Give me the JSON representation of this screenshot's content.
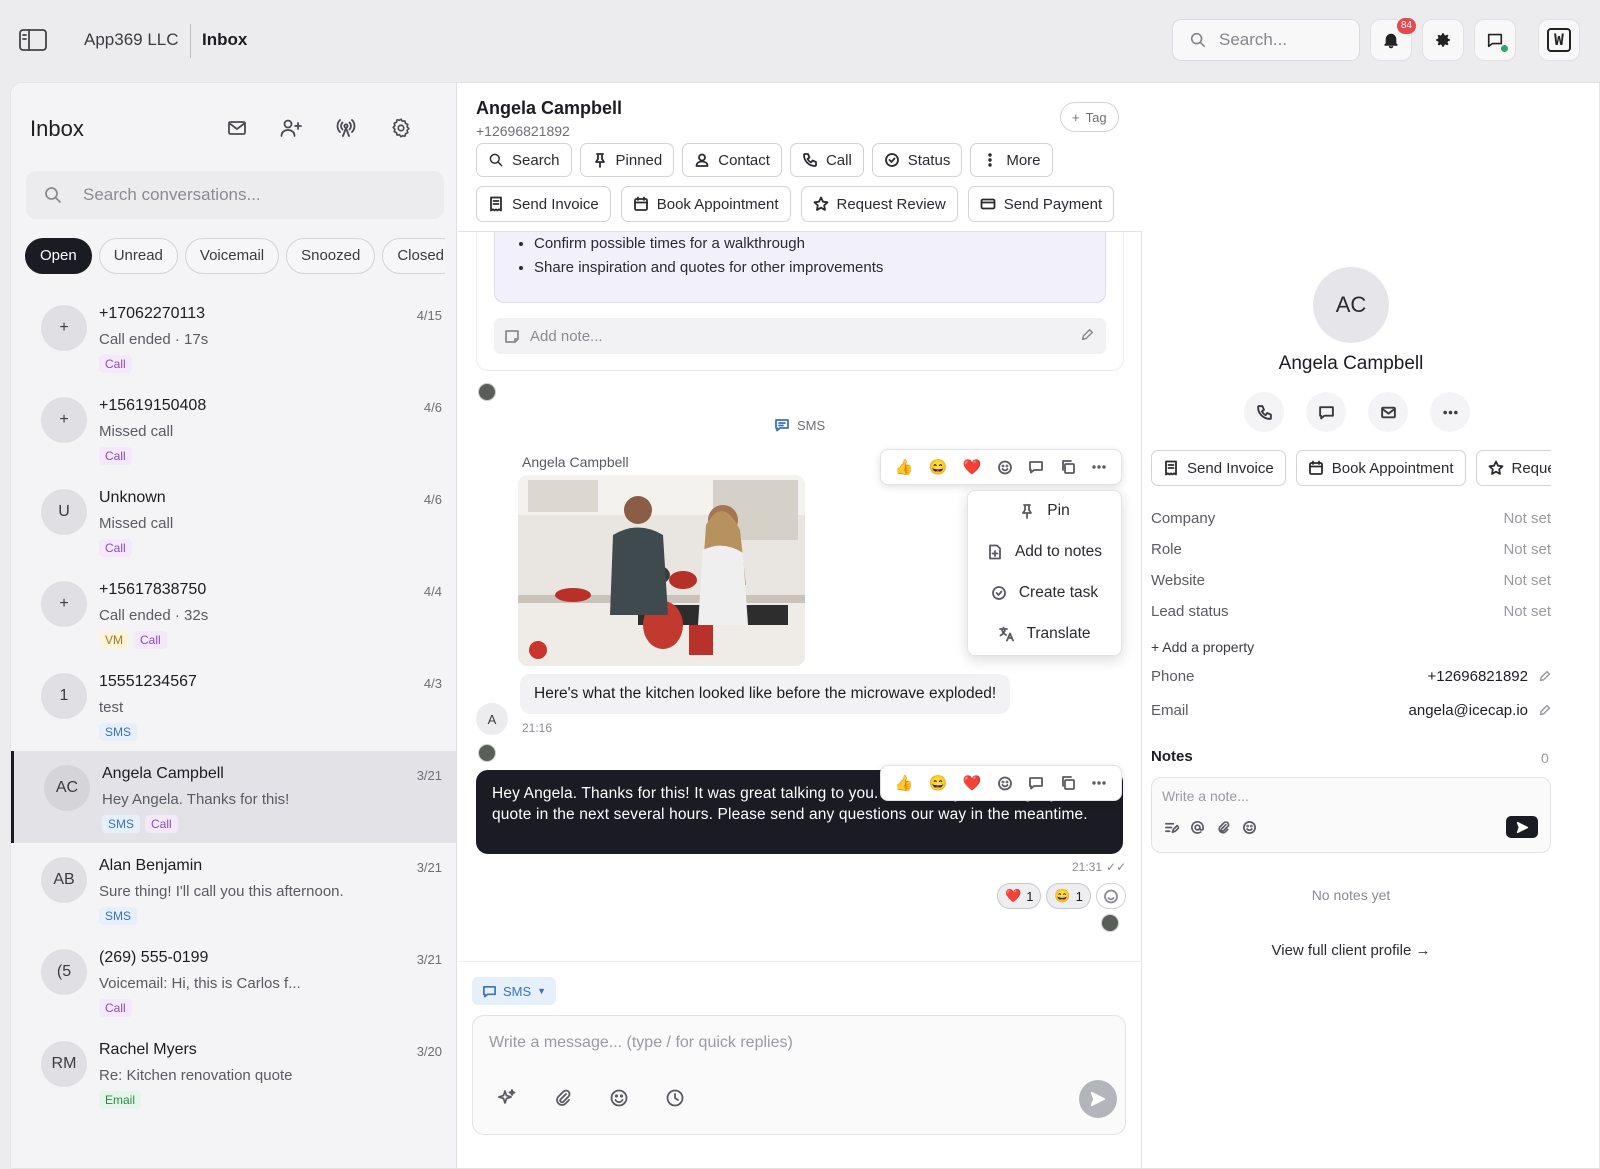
{
  "topbar": {
    "org": "App369 LLC",
    "crumb": "Inbox",
    "search_placeholder": "Search...",
    "notification_count": "84",
    "user_initial": "W"
  },
  "left": {
    "title": "Inbox",
    "search_placeholder": "Search conversations...",
    "filters": [
      "Open",
      "Unread",
      "Voicemail",
      "Snoozed",
      "Closed"
    ],
    "conversations": [
      {
        "avatar": "+",
        "name": "+17062270113",
        "date": "4/15",
        "preview": "Call ended · 17s",
        "tags": [
          "Call"
        ]
      },
      {
        "avatar": "+",
        "name": "+15619150408",
        "date": "4/6",
        "preview": "Missed call",
        "tags": [
          "Call"
        ]
      },
      {
        "avatar": "U",
        "name": "Unknown",
        "date": "4/6",
        "preview": "Missed call",
        "tags": [
          "Call"
        ]
      },
      {
        "avatar": "+",
        "name": "+15617838750",
        "date": "4/4",
        "preview": "Call ended · 32s",
        "tags": [
          "VM",
          "Call"
        ]
      },
      {
        "avatar": "1",
        "name": " 15551234567",
        "date": "4/3",
        "preview": "test",
        "tags": [
          "SMS"
        ]
      },
      {
        "avatar": "AC",
        "name": "Angela Campbell",
        "date": "3/21",
        "preview": "Hey Angela. Thanks for this!",
        "tags": [
          "SMS",
          "Call"
        ],
        "selected": true
      },
      {
        "avatar": "AB",
        "name": "Alan Benjamin",
        "date": "3/21",
        "preview": "Sure thing! I'll call you this afternoon.",
        "tags": [
          "SMS"
        ]
      },
      {
        "avatar": "(5",
        "name": "(269) 555-0199",
        "date": "3/21",
        "preview": "Voicemail: Hi, this is Carlos f...",
        "tags": [
          "Call"
        ]
      },
      {
        "avatar": "RM",
        "name": "Rachel Myers",
        "date": "3/20",
        "preview": "Re: Kitchen renovation quote",
        "tags": [
          "Email"
        ]
      }
    ]
  },
  "center": {
    "name": "Angela Campbell",
    "phone": "+12696821892",
    "tag_label": "Tag",
    "actions": {
      "search": "Search",
      "pinned": "Pinned",
      "contact": "Contact",
      "call": "Call",
      "status": "Status",
      "more": "More"
    },
    "quick": {
      "invoice": "Send Invoice",
      "appointment": "Book Appointment",
      "review": "Request Review",
      "payment": "Send Payment"
    },
    "summary_items": [
      "Confirm possible times for a walkthrough",
      "Share inspiration and quotes for other improvements"
    ],
    "add_note_placeholder": "Add note...",
    "divider_label": "SMS",
    "incoming": {
      "sender": "Angela Campbell",
      "avatar": "A",
      "text": "Here's what the kitchen looked like before the microwave exploded!",
      "time": "21:16"
    },
    "menu": {
      "pin": "Pin",
      "add_notes": "Add to notes",
      "task": "Create task",
      "translate": "Translate"
    },
    "outgoing": {
      "text": "Hey Angela. Thanks for this! It was great talking to you. I'll have my team to get you a quote in the next several hours. Please send any questions our way in the meantime.",
      "time": "21:31"
    },
    "reactions": [
      {
        "emoji": "❤️",
        "count": "1"
      },
      {
        "emoji": "😄",
        "count": "1"
      }
    ],
    "composer": {
      "channel": "SMS",
      "placeholder": "Write a message... (type / for quick replies)"
    }
  },
  "right": {
    "initials": "AC",
    "name": "Angela Campbell",
    "quick": {
      "invoice": "Send Invoice",
      "appointment": "Book Appointment",
      "review": "Request Review"
    },
    "props": [
      {
        "label": "Company",
        "value": "Not set"
      },
      {
        "label": "Role",
        "value": "Not set"
      },
      {
        "label": "Website",
        "value": "Not set"
      },
      {
        "label": "Lead status",
        "value": "Not set"
      }
    ],
    "add_property": "+ Add a property",
    "phone_label": "Phone",
    "phone": "+12696821892",
    "email_label": "Email",
    "email": "angela@icecap.io",
    "notes_title": "Notes",
    "notes_count": "0",
    "note_placeholder": "Write a note...",
    "no_notes": "No notes yet",
    "full_profile": "View full client profile →"
  }
}
